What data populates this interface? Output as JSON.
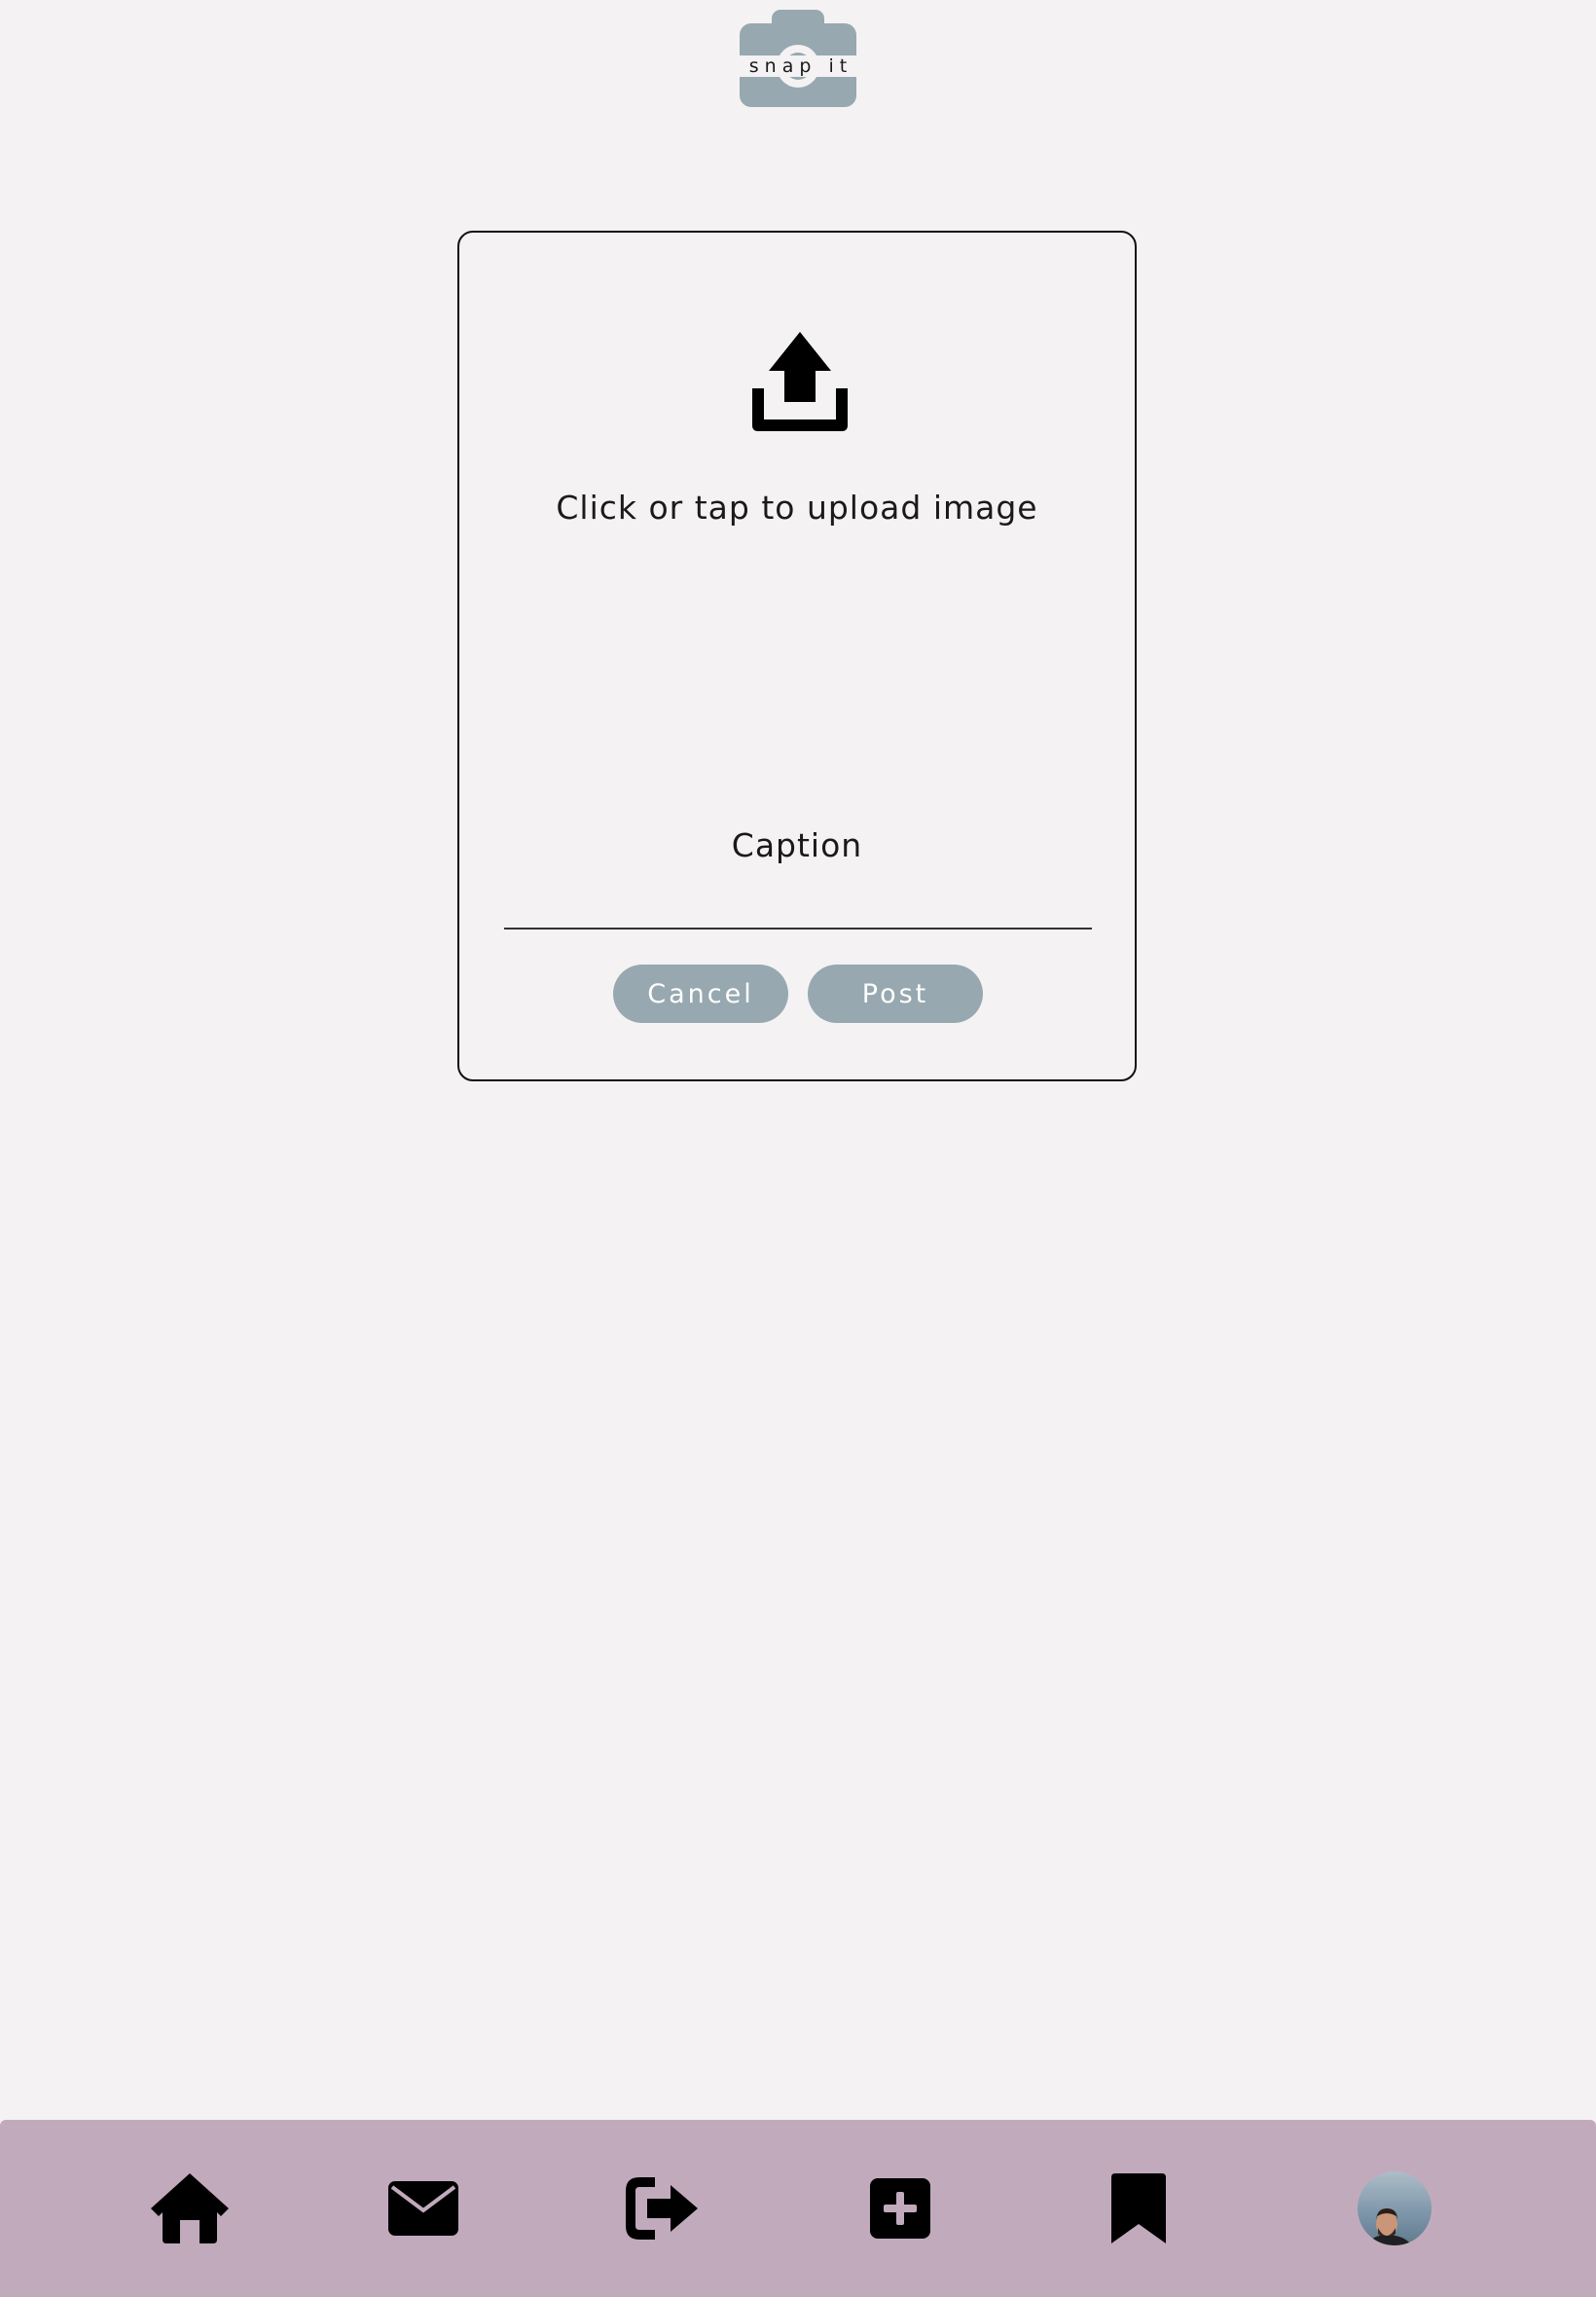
{
  "logo": {
    "text": "snap it",
    "icon": "camera-icon",
    "color": "#97a8b0"
  },
  "upload": {
    "icon": "upload-icon",
    "prompt": "Click or tap to upload image"
  },
  "caption": {
    "label": "Caption",
    "value": "",
    "placeholder": ""
  },
  "actions": {
    "cancel_label": "Cancel",
    "post_label": "Post",
    "button_color": "#97a8b0"
  },
  "nav": {
    "background": "#c2aabd",
    "items": [
      {
        "name": "home",
        "icon": "home-icon"
      },
      {
        "name": "messages",
        "icon": "envelope-icon"
      },
      {
        "name": "logout",
        "icon": "sign-out-icon"
      },
      {
        "name": "new-post",
        "icon": "plus-square-icon"
      },
      {
        "name": "saved",
        "icon": "bookmark-icon"
      },
      {
        "name": "profile",
        "icon": "avatar"
      }
    ]
  }
}
